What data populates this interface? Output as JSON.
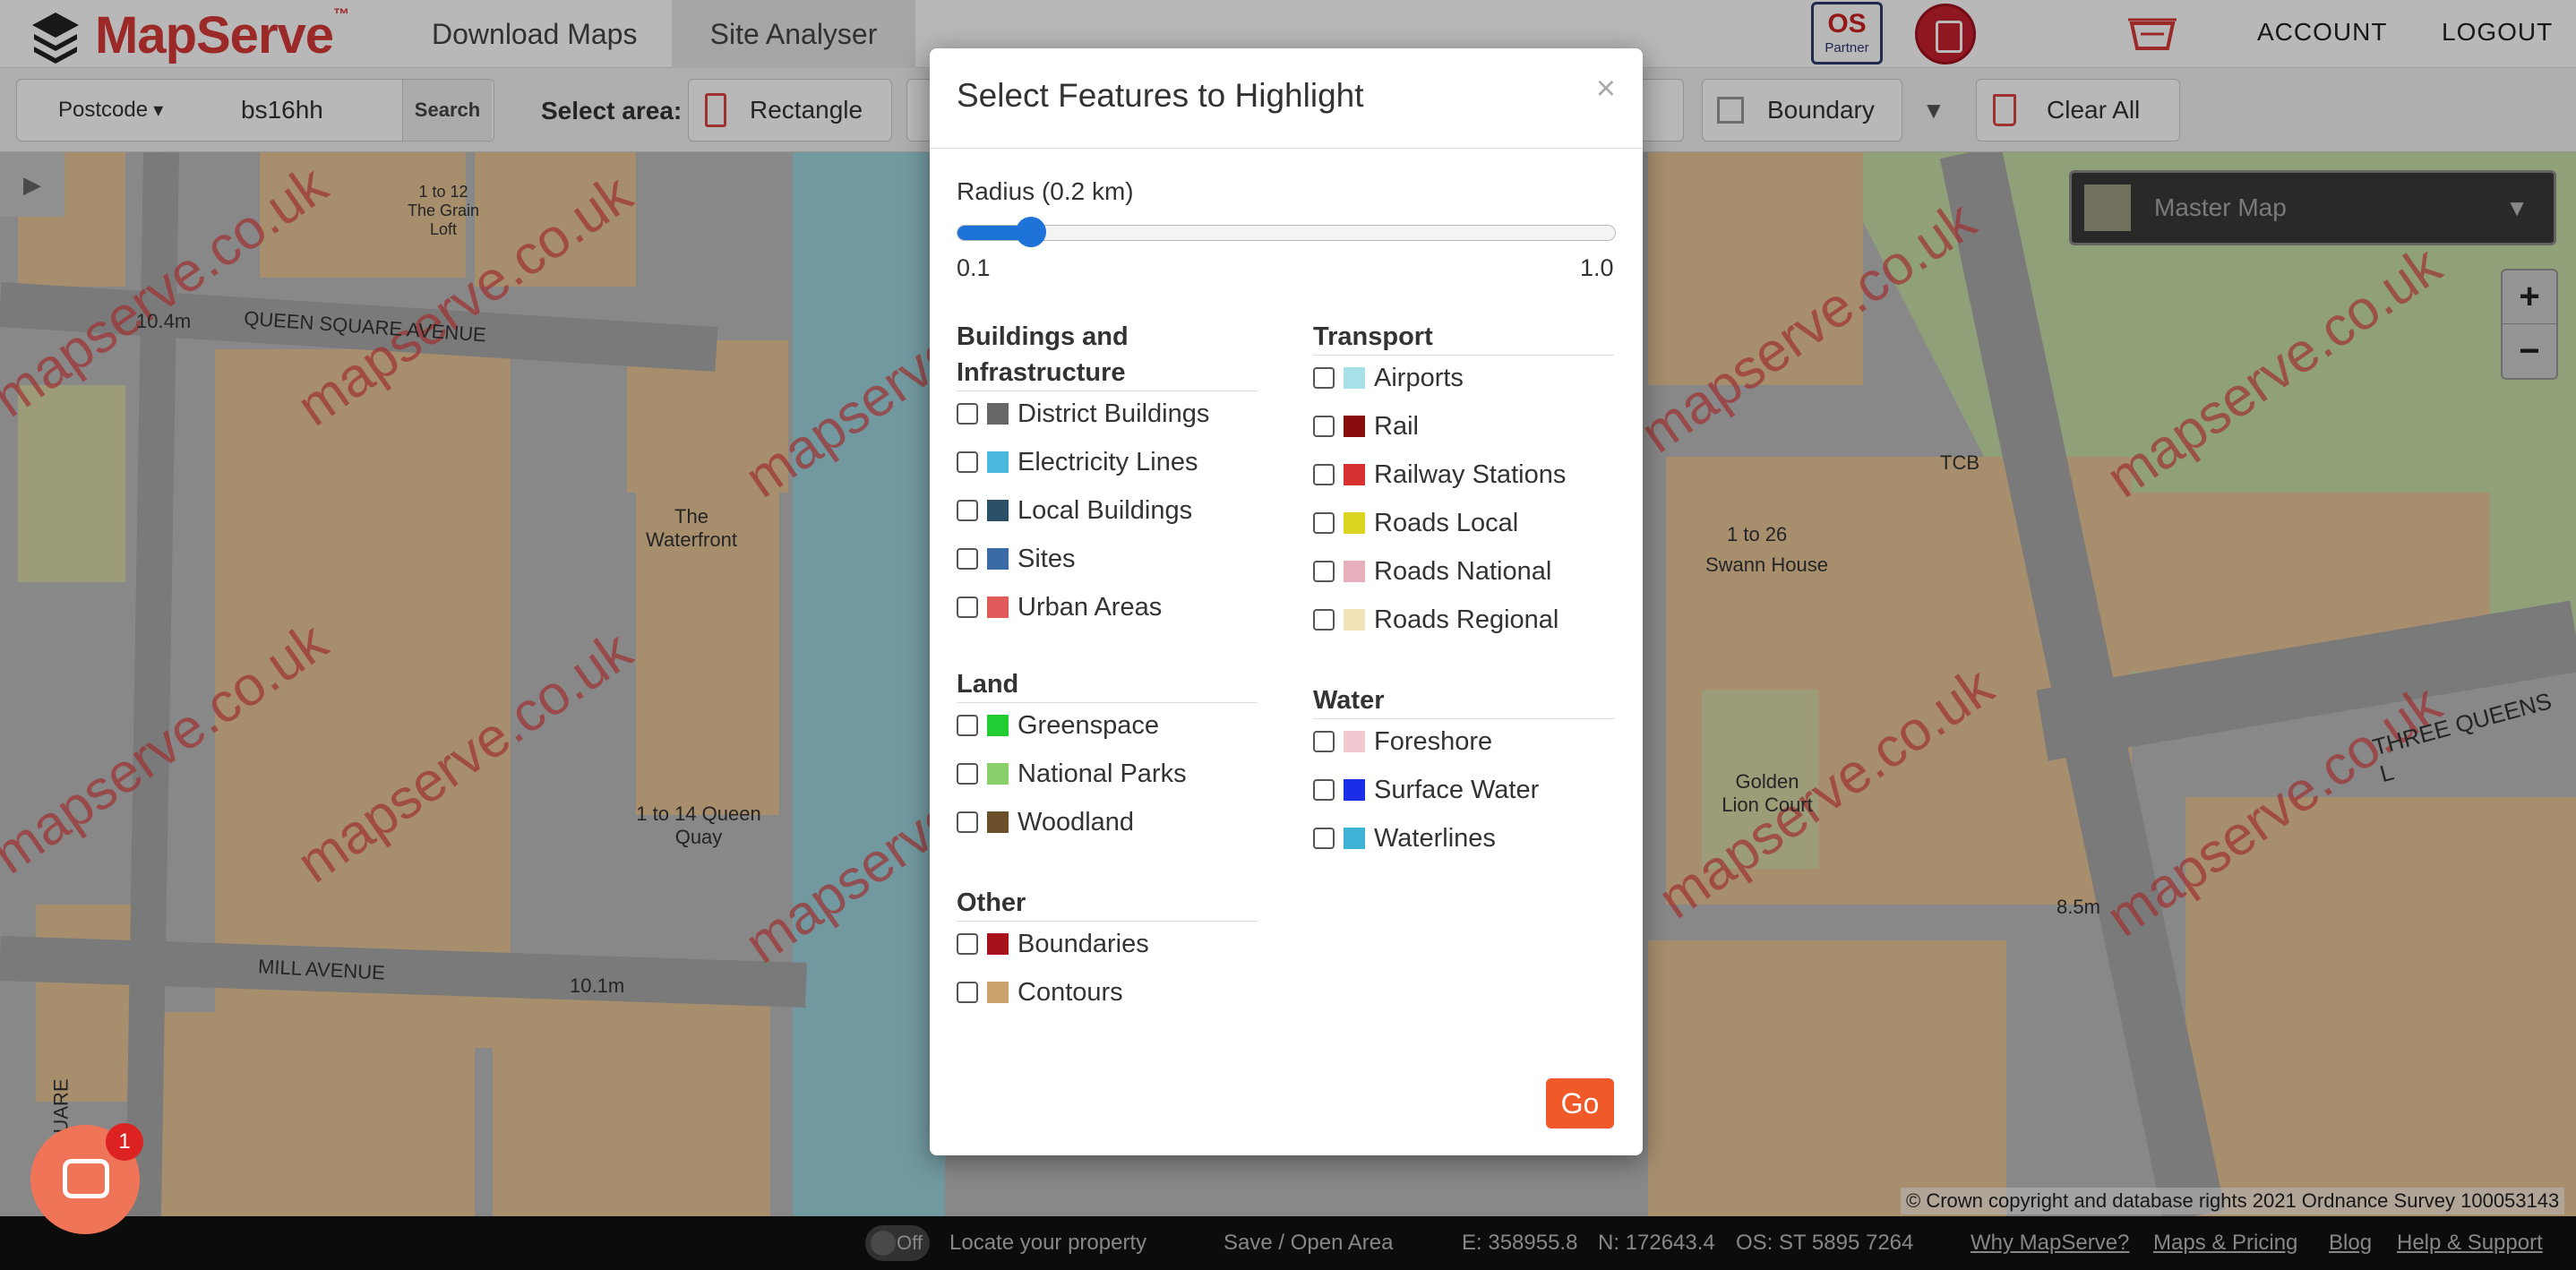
{
  "brand": {
    "name": "MapServe",
    "tm": "™"
  },
  "nav": {
    "tabs": [
      {
        "label": "Download Maps"
      },
      {
        "label": "Site Analyser"
      }
    ],
    "partner_badge": "Partner",
    "partner_letters": "OS",
    "account": "ACCOUNT",
    "logout": "LOGOUT"
  },
  "toolbar": {
    "postcode_dropdown": "Postcode",
    "postcode_value": "bs16hh",
    "search_label": "Search",
    "select_area_label": "Select area:",
    "rectangle_label": "Rectangle",
    "boundary_label": "Boundary",
    "clear_label": "Clear All"
  },
  "map": {
    "layer_label": "Master Map",
    "zoom_in": "+",
    "zoom_out": "−",
    "copyright": "© Crown copyright and database rights 2021 Ordnance Survey 100053143",
    "watermark": "mapserve.co.uk",
    "labels": {
      "queen_square_avenue": "QUEEN SQUARE AVENUE",
      "mill_avenue": "MILL AVENUE",
      "queen_square": "QUEEN SQUARE",
      "three_queens": "THREE QUEENS L",
      "waterfront": "The Waterfront",
      "queen_quay": "1 to 14 Queen Quay",
      "grain_loft": "1 to 12 The Grain Loft",
      "swann_house": "Swann House",
      "swann_range": "1 to 26",
      "golden_lion": "Golden Lion Court",
      "tcb": "TCB",
      "spot_104": "10.4m",
      "spot_101": "10.1m",
      "spot_85": "8.5m"
    }
  },
  "chat": {
    "badge": "1"
  },
  "footer": {
    "toggle": "Off",
    "locate": "Locate your property",
    "save": "Save / Open Area",
    "easting": "E: 358955.8",
    "northing": "N: 172643.4",
    "os_ref": "OS: ST 5895 7264",
    "links": [
      "Why MapServe?",
      "Maps & Pricing",
      "Blog",
      "Help & Support"
    ]
  },
  "modal": {
    "title": "Select Features to Highlight",
    "close": "×",
    "radius_label": "Radius (0.2 km)",
    "radius": {
      "min": 0.1,
      "max": 1.0,
      "value": 0.2,
      "min_label": "0.1",
      "max_label": "1.0"
    },
    "go_label": "Go",
    "sections": {
      "buildings": {
        "title": "Buildings and Infrastructure",
        "items": [
          {
            "label": "District Buildings",
            "color": "#666666"
          },
          {
            "label": "Electricity Lines",
            "color": "#4ab8e0"
          },
          {
            "label": "Local Buildings",
            "color": "#2a4f66"
          },
          {
            "label": "Sites",
            "color": "#3b6aa8"
          },
          {
            "label": "Urban Areas",
            "color": "#e05a5a"
          }
        ]
      },
      "land": {
        "title": "Land",
        "items": [
          {
            "label": "Greenspace",
            "color": "#22cc33"
          },
          {
            "label": "National Parks",
            "color": "#88d06a"
          },
          {
            "label": "Woodland",
            "color": "#6b4f2a"
          }
        ]
      },
      "other": {
        "title": "Other",
        "items": [
          {
            "label": "Boundaries",
            "color": "#a8101c"
          },
          {
            "label": "Contours",
            "color": "#c9a36b"
          }
        ]
      },
      "transport": {
        "title": "Transport",
        "items": [
          {
            "label": "Airports",
            "color": "#a8e0e8"
          },
          {
            "label": "Rail",
            "color": "#8a0d0d"
          },
          {
            "label": "Railway Stations",
            "color": "#d83030"
          },
          {
            "label": "Roads Local",
            "color": "#d8d420"
          },
          {
            "label": "Roads National",
            "color": "#e8b0bc"
          },
          {
            "label": "Roads Regional",
            "color": "#f2e2b8"
          }
        ]
      },
      "water": {
        "title": "Water",
        "items": [
          {
            "label": "Foreshore",
            "color": "#f4c8d0"
          },
          {
            "label": "Surface Water",
            "color": "#1a2ee8"
          },
          {
            "label": "Waterlines",
            "color": "#40b4d8"
          }
        ]
      }
    }
  }
}
